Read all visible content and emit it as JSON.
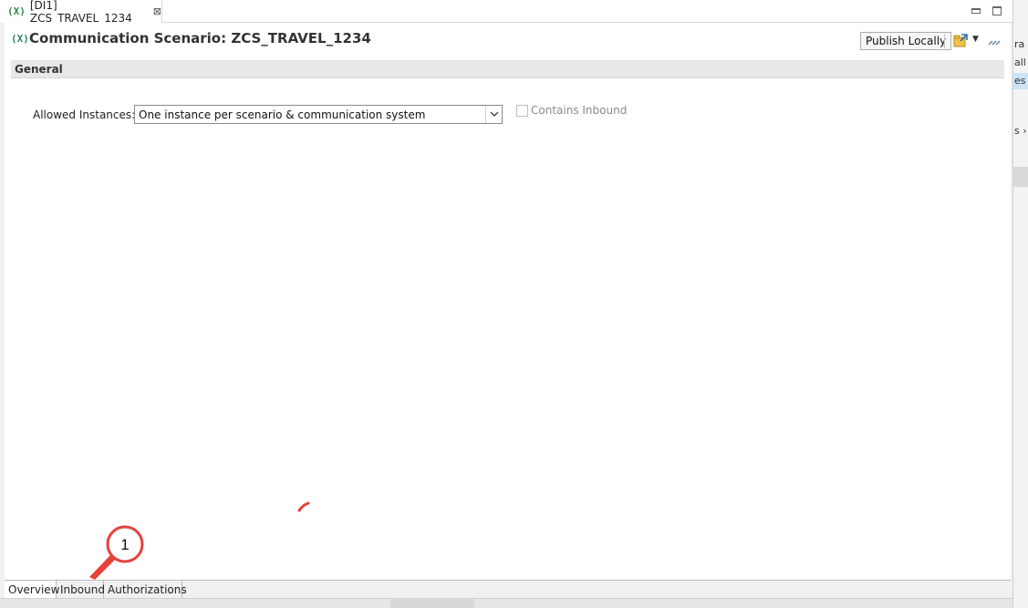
{
  "editor_tab": {
    "icon": "(X)",
    "label": "[DI1] ZCS_TRAVEL_1234",
    "close": "⊠"
  },
  "header": {
    "icon": "(X)",
    "title": "Communication Scenario: ZCS_TRAVEL_1234",
    "publish_label": "Publish Locally"
  },
  "section": {
    "title": "General"
  },
  "form": {
    "allowed_instances_label": "Allowed Instances: *",
    "allowed_instances_value": "One instance per scenario & communication system",
    "contains_inbound_label": "Contains Inbound",
    "contains_inbound_checked": false
  },
  "bottom_tabs": {
    "overview": "Overview",
    "inbound": "Inbound",
    "authorizations": "Authorizations"
  },
  "right_panel": {
    "line1": "ra l",
    "line2": "all i",
    "line3": "es",
    "line4": "s ›"
  },
  "annotation": {
    "callout_number": "1",
    "color": "#e8413c"
  },
  "colors": {
    "accent_green": "#2e8b57",
    "selection_blue": "#cce4f7"
  }
}
